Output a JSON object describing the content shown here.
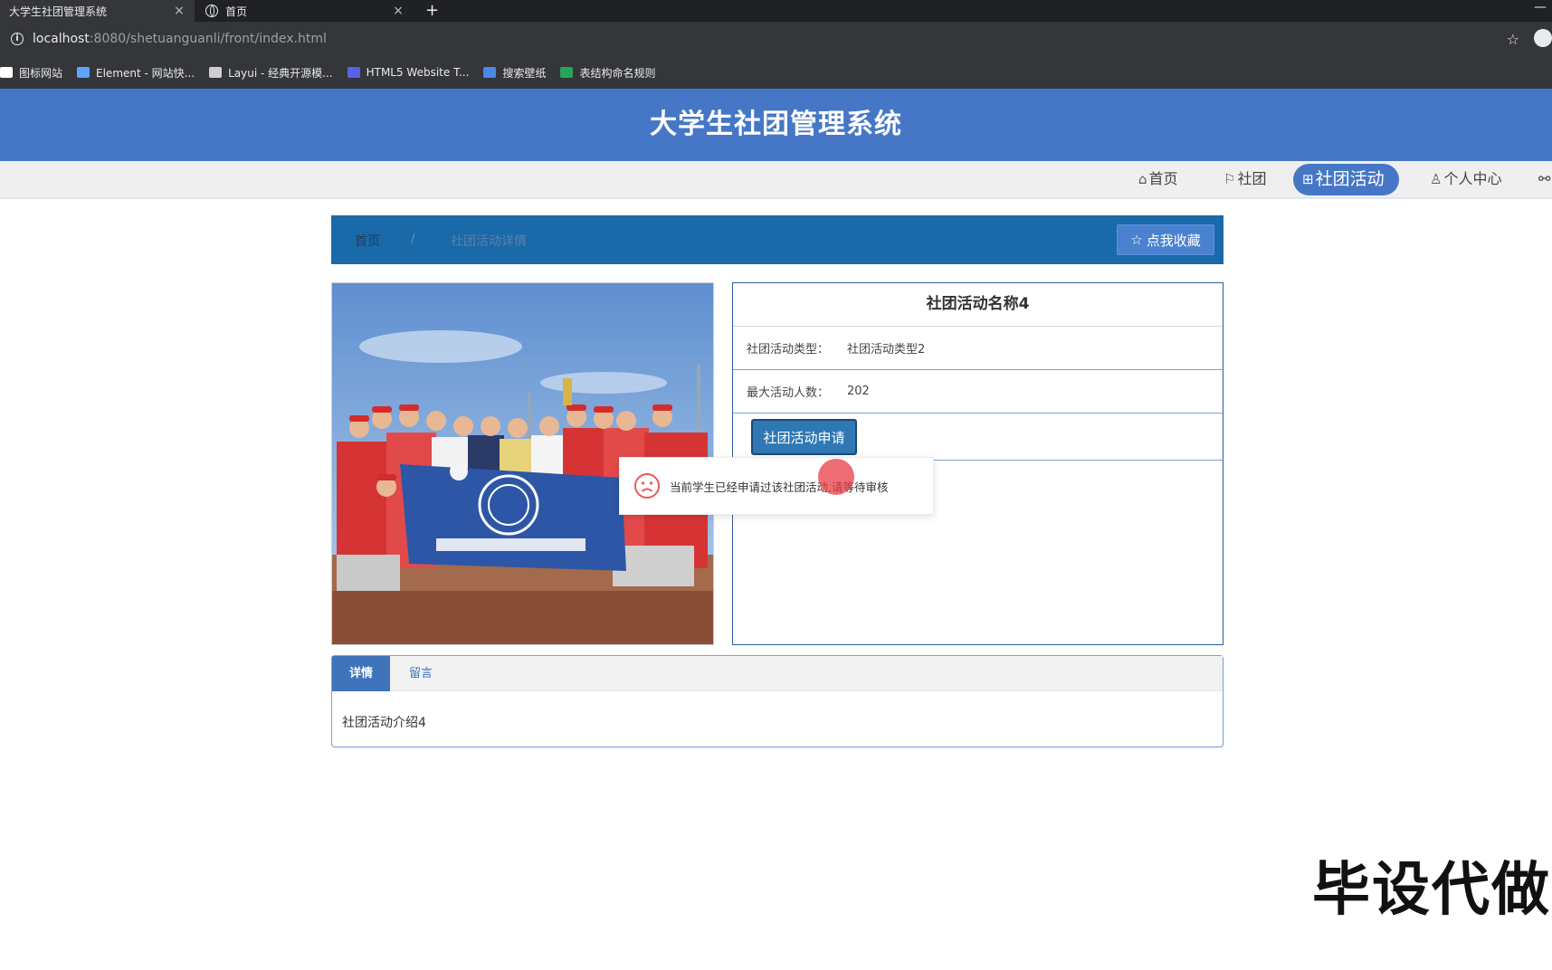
{
  "browser": {
    "tabs": [
      {
        "title": "大学生社团管理系统",
        "close": "×"
      },
      {
        "title": "首页",
        "close": "×"
      }
    ],
    "new_tab": "+",
    "address": {
      "host": "localhost",
      "path": ":8080/shetuanguanli/front/index.html"
    },
    "bookmarks": [
      {
        "label": "图标网站",
        "color": "#ffffff"
      },
      {
        "label": "Element - 网站快...",
        "color": "#5ba4ff"
      },
      {
        "label": "Layui - 经典开源模...",
        "color": "#cfcfcf"
      },
      {
        "label": "HTML5 Website T...",
        "color": "#5863e6"
      },
      {
        "label": "搜索壁纸",
        "color": "#4b86e8"
      },
      {
        "label": "表结构命名规则",
        "color": "#26a65b"
      }
    ]
  },
  "site": {
    "title": "大学生社团管理系统",
    "nav": {
      "home": "首页",
      "club": "社团",
      "activity": "社团活动",
      "profile": "个人中心"
    }
  },
  "breadcrumb": {
    "home": "首页",
    "separator": "/",
    "current": "社团活动详情"
  },
  "favorite_button": "点我收藏",
  "activity": {
    "name": "社团活动名称4",
    "type_label": "社团活动类型：",
    "type_value": "社团活动类型2",
    "max_label": "最大活动人数：",
    "max_value": "202",
    "apply_button": "社团活动申请"
  },
  "toast": {
    "message": "当前学生已经申请过该社团活动,请等待审核"
  },
  "detail_tabs": {
    "detail": "详情",
    "comment": "留言",
    "content": "社团活动介绍4"
  },
  "watermark": "毕设代做",
  "colors": {
    "header": "#4677c6",
    "breadcrumb": "#1a69a8",
    "accent": "#3f74bb"
  }
}
